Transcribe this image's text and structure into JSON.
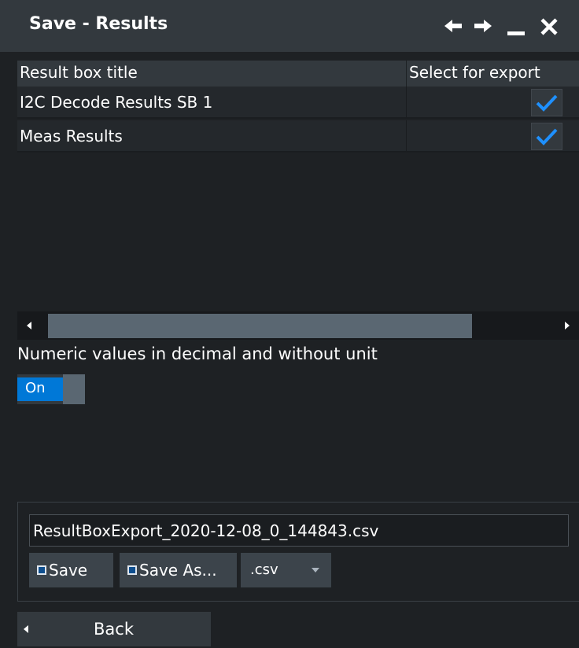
{
  "window": {
    "title": "Save - Results",
    "controls": {
      "back_icon": "left-arrow-icon",
      "forward_icon": "right-arrow-icon",
      "minimize_icon": "minimize-icon",
      "close_icon": "close-icon"
    }
  },
  "table": {
    "headers": {
      "title": "Result box title",
      "select": "Select for export"
    },
    "rows": [
      {
        "title": "I2C Decode Results SB 1",
        "selected": true
      },
      {
        "title": "Meas Results",
        "selected": true
      }
    ]
  },
  "options": {
    "numeric_label": "Numeric values in decimal and without unit",
    "toggle_label": "On",
    "toggle_state": true
  },
  "save": {
    "filename": "ResultBoxExport_2020-12-08_0_144843.csv",
    "save_label": "Save",
    "save_as_label": "Save As...",
    "format_selected": ".csv"
  },
  "nav": {
    "back_label": "Back"
  },
  "colors": {
    "background": "#1e2124",
    "titlebar": "#33393e",
    "accent": "#0078d7",
    "check": "#1e90ff"
  }
}
